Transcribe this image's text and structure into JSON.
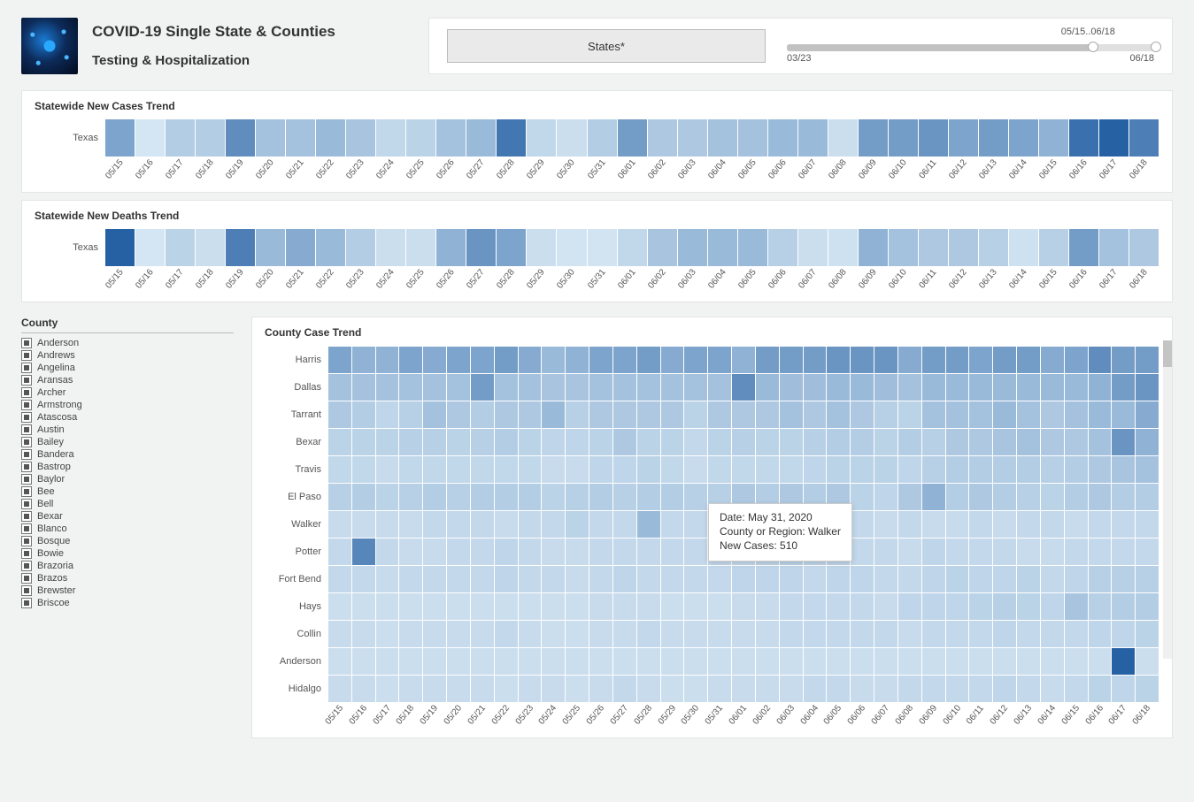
{
  "header": {
    "title": "COVID-19 Single State & Counties",
    "subtitle": "Testing & Hospitalization",
    "states_button": "States*",
    "slider": {
      "range_label": "05/15..06/18",
      "start": "03/23",
      "end": "06/18"
    }
  },
  "cases_trend": {
    "title": "Statewide New Cases Trend",
    "state": "Texas"
  },
  "deaths_trend": {
    "title": "Statewide New Deaths Trend",
    "state": "Texas"
  },
  "county_filter": {
    "title": "County",
    "items": [
      "Anderson",
      "Andrews",
      "Angelina",
      "Aransas",
      "Archer",
      "Armstrong",
      "Atascosa",
      "Austin",
      "Bailey",
      "Bandera",
      "Bastrop",
      "Baylor",
      "Bee",
      "Bell",
      "Bexar",
      "Blanco",
      "Bosque",
      "Bowie",
      "Brazoria",
      "Brazos",
      "Brewster",
      "Briscoe"
    ]
  },
  "county_trend": {
    "title": "County Case Trend",
    "counties": [
      "Harris",
      "Dallas",
      "Tarrant",
      "Bexar",
      "Travis",
      "El Paso",
      "Walker",
      "Potter",
      "Fort Bend",
      "Hays",
      "Collin",
      "Anderson",
      "Hidalgo"
    ]
  },
  "tooltip": {
    "date_label": "Date: May 31, 2020",
    "region_label": "County or Region: Walker",
    "value_label": "New Cases:  510"
  },
  "dates": [
    "05/15",
    "05/16",
    "05/17",
    "05/18",
    "05/19",
    "05/20",
    "05/21",
    "05/22",
    "05/23",
    "05/24",
    "05/25",
    "05/26",
    "05/27",
    "05/28",
    "05/29",
    "05/30",
    "05/31",
    "06/01",
    "06/02",
    "06/03",
    "06/04",
    "06/05",
    "06/06",
    "06/07",
    "06/08",
    "06/09",
    "06/10",
    "06/11",
    "06/12",
    "06/13",
    "06/14",
    "06/15",
    "06/16",
    "06/17",
    "06/18"
  ],
  "chart_data": [
    {
      "type": "heatmap",
      "title": "Statewide New Cases Trend",
      "xlabel": "Date",
      "ylabel": "State",
      "categories": [
        "05/15",
        "05/16",
        "05/17",
        "05/18",
        "05/19",
        "05/20",
        "05/21",
        "05/22",
        "05/23",
        "05/24",
        "05/25",
        "05/26",
        "05/27",
        "05/28",
        "05/29",
        "05/30",
        "05/31",
        "06/01",
        "06/02",
        "06/03",
        "06/04",
        "06/05",
        "06/06",
        "06/07",
        "06/08",
        "06/09",
        "06/10",
        "06/11",
        "06/12",
        "06/13",
        "06/14",
        "06/15",
        "06/16",
        "06/17",
        "06/18"
      ],
      "series": [
        {
          "name": "Texas",
          "values": [
            0.5,
            0.05,
            0.22,
            0.22,
            0.65,
            0.3,
            0.3,
            0.35,
            0.28,
            0.15,
            0.18,
            0.3,
            0.35,
            0.8,
            0.15,
            0.1,
            0.22,
            0.55,
            0.25,
            0.25,
            0.3,
            0.3,
            0.35,
            0.35,
            0.1,
            0.55,
            0.55,
            0.6,
            0.5,
            0.55,
            0.5,
            0.4,
            0.85,
            0.95,
            0.75
          ]
        }
      ],
      "note": "values are relative intensities (0..1) read from color shading; absolute case counts not labeled"
    },
    {
      "type": "heatmap",
      "title": "Statewide New Deaths Trend",
      "xlabel": "Date",
      "ylabel": "State",
      "categories": [
        "05/15",
        "05/16",
        "05/17",
        "05/18",
        "05/19",
        "05/20",
        "05/21",
        "05/22",
        "05/23",
        "05/24",
        "05/25",
        "05/26",
        "05/27",
        "05/28",
        "05/29",
        "05/30",
        "05/31",
        "06/01",
        "06/02",
        "06/03",
        "06/04",
        "06/05",
        "06/06",
        "06/07",
        "06/08",
        "06/09",
        "06/10",
        "06/11",
        "06/12",
        "06/13",
        "06/14",
        "06/15",
        "06/16",
        "06/17",
        "06/18"
      ],
      "series": [
        {
          "name": "Texas",
          "values": [
            0.95,
            0.05,
            0.18,
            0.1,
            0.75,
            0.35,
            0.45,
            0.35,
            0.22,
            0.1,
            0.1,
            0.4,
            0.6,
            0.5,
            0.1,
            0.06,
            0.06,
            0.15,
            0.28,
            0.35,
            0.35,
            0.35,
            0.2,
            0.1,
            0.08,
            0.4,
            0.3,
            0.25,
            0.25,
            0.2,
            0.08,
            0.2,
            0.55,
            0.3,
            0.25
          ]
        }
      ],
      "note": "relative intensities (0..1) from shading"
    },
    {
      "type": "heatmap",
      "title": "County Case Trend",
      "xlabel": "Date",
      "ylabel": "County",
      "categories": [
        "05/15",
        "05/16",
        "05/17",
        "05/18",
        "05/19",
        "05/20",
        "05/21",
        "05/22",
        "05/23",
        "05/24",
        "05/25",
        "05/26",
        "05/27",
        "05/28",
        "05/29",
        "05/30",
        "05/31",
        "06/01",
        "06/02",
        "06/03",
        "06/04",
        "06/05",
        "06/06",
        "06/07",
        "06/08",
        "06/09",
        "06/10",
        "06/11",
        "06/12",
        "06/13",
        "06/14",
        "06/15",
        "06/16",
        "06/17",
        "06/18"
      ],
      "series": [
        {
          "name": "Harris",
          "values": [
            0.5,
            0.4,
            0.4,
            0.5,
            0.45,
            0.5,
            0.5,
            0.55,
            0.45,
            0.35,
            0.4,
            0.5,
            0.5,
            0.55,
            0.45,
            0.5,
            0.5,
            0.4,
            0.55,
            0.55,
            0.55,
            0.6,
            0.6,
            0.6,
            0.45,
            0.55,
            0.55,
            0.5,
            0.55,
            0.55,
            0.45,
            0.5,
            0.65,
            0.55,
            0.55
          ]
        },
        {
          "name": "Dallas",
          "values": [
            0.3,
            0.3,
            0.3,
            0.3,
            0.3,
            0.3,
            0.55,
            0.3,
            0.3,
            0.28,
            0.28,
            0.3,
            0.3,
            0.3,
            0.3,
            0.3,
            0.3,
            0.65,
            0.35,
            0.32,
            0.32,
            0.35,
            0.35,
            0.32,
            0.3,
            0.35,
            0.35,
            0.35,
            0.35,
            0.35,
            0.35,
            0.35,
            0.4,
            0.55,
            0.6
          ]
        },
        {
          "name": "Tarrant",
          "values": [
            0.25,
            0.22,
            0.16,
            0.2,
            0.3,
            0.25,
            0.22,
            0.25,
            0.25,
            0.35,
            0.2,
            0.25,
            0.25,
            0.25,
            0.25,
            0.18,
            0.25,
            0.25,
            0.25,
            0.3,
            0.25,
            0.3,
            0.25,
            0.2,
            0.18,
            0.3,
            0.3,
            0.3,
            0.35,
            0.3,
            0.25,
            0.3,
            0.35,
            0.35,
            0.45
          ]
        },
        {
          "name": "Bexar",
          "values": [
            0.18,
            0.18,
            0.18,
            0.2,
            0.2,
            0.18,
            0.2,
            0.22,
            0.18,
            0.16,
            0.16,
            0.18,
            0.25,
            0.18,
            0.18,
            0.14,
            0.18,
            0.2,
            0.18,
            0.18,
            0.2,
            0.22,
            0.22,
            0.18,
            0.22,
            0.2,
            0.25,
            0.25,
            0.28,
            0.3,
            0.25,
            0.25,
            0.3,
            0.6,
            0.4
          ]
        },
        {
          "name": "Travis",
          "values": [
            0.15,
            0.15,
            0.12,
            0.15,
            0.15,
            0.15,
            0.15,
            0.15,
            0.15,
            0.12,
            0.12,
            0.16,
            0.16,
            0.18,
            0.15,
            0.12,
            0.15,
            0.15,
            0.15,
            0.15,
            0.16,
            0.18,
            0.18,
            0.18,
            0.16,
            0.2,
            0.22,
            0.22,
            0.22,
            0.22,
            0.2,
            0.22,
            0.25,
            0.28,
            0.3
          ]
        },
        {
          "name": "El Paso",
          "values": [
            0.2,
            0.22,
            0.18,
            0.2,
            0.22,
            0.2,
            0.22,
            0.22,
            0.22,
            0.18,
            0.2,
            0.22,
            0.2,
            0.22,
            0.22,
            0.2,
            0.2,
            0.25,
            0.22,
            0.25,
            0.22,
            0.25,
            0.18,
            0.16,
            0.25,
            0.4,
            0.22,
            0.25,
            0.22,
            0.2,
            0.18,
            0.22,
            0.25,
            0.22,
            0.22
          ]
        },
        {
          "name": "Walker",
          "values": [
            0.12,
            0.12,
            0.12,
            0.12,
            0.14,
            0.14,
            0.14,
            0.12,
            0.14,
            0.14,
            0.18,
            0.14,
            0.14,
            0.35,
            0.14,
            0.14,
            0.6,
            0.14,
            0.3,
            0.25,
            0.14,
            0.18,
            0.14,
            0.12,
            0.14,
            0.12,
            0.12,
            0.14,
            0.12,
            0.14,
            0.14,
            0.12,
            0.14,
            0.14,
            0.14
          ]
        },
        {
          "name": "Potter",
          "values": [
            0.14,
            0.7,
            0.14,
            0.12,
            0.12,
            0.14,
            0.14,
            0.16,
            0.14,
            0.12,
            0.12,
            0.14,
            0.14,
            0.14,
            0.14,
            0.14,
            0.14,
            0.14,
            0.16,
            0.18,
            0.16,
            0.16,
            0.14,
            0.14,
            0.12,
            0.16,
            0.14,
            0.14,
            0.14,
            0.12,
            0.12,
            0.14,
            0.14,
            0.14,
            0.14
          ]
        },
        {
          "name": "Fort Bend",
          "values": [
            0.14,
            0.14,
            0.12,
            0.14,
            0.14,
            0.14,
            0.14,
            0.16,
            0.14,
            0.14,
            0.12,
            0.14,
            0.16,
            0.14,
            0.14,
            0.14,
            0.14,
            0.16,
            0.16,
            0.16,
            0.14,
            0.16,
            0.16,
            0.14,
            0.14,
            0.16,
            0.18,
            0.16,
            0.16,
            0.18,
            0.14,
            0.16,
            0.2,
            0.2,
            0.2
          ]
        },
        {
          "name": "Hays",
          "values": [
            0.1,
            0.1,
            0.1,
            0.1,
            0.1,
            0.1,
            0.1,
            0.1,
            0.1,
            0.1,
            0.1,
            0.12,
            0.12,
            0.12,
            0.1,
            0.1,
            0.1,
            0.12,
            0.12,
            0.14,
            0.14,
            0.14,
            0.14,
            0.12,
            0.16,
            0.16,
            0.16,
            0.18,
            0.2,
            0.18,
            0.16,
            0.28,
            0.2,
            0.22,
            0.22
          ]
        },
        {
          "name": "Collin",
          "values": [
            0.12,
            0.12,
            0.1,
            0.12,
            0.12,
            0.12,
            0.12,
            0.14,
            0.12,
            0.1,
            0.1,
            0.12,
            0.12,
            0.14,
            0.12,
            0.12,
            0.12,
            0.12,
            0.12,
            0.14,
            0.14,
            0.14,
            0.14,
            0.14,
            0.12,
            0.14,
            0.14,
            0.14,
            0.16,
            0.14,
            0.14,
            0.14,
            0.16,
            0.16,
            0.18
          ]
        },
        {
          "name": "Anderson",
          "values": [
            0.1,
            0.1,
            0.1,
            0.1,
            0.1,
            0.1,
            0.1,
            0.1,
            0.1,
            0.1,
            0.1,
            0.1,
            0.1,
            0.1,
            0.1,
            0.1,
            0.1,
            0.1,
            0.1,
            0.1,
            0.1,
            0.1,
            0.1,
            0.1,
            0.1,
            0.1,
            0.1,
            0.1,
            0.1,
            0.1,
            0.1,
            0.1,
            0.1,
            0.95,
            0.1
          ]
        },
        {
          "name": "Hidalgo",
          "values": [
            0.12,
            0.12,
            0.1,
            0.12,
            0.12,
            0.12,
            0.12,
            0.1,
            0.12,
            0.12,
            0.1,
            0.12,
            0.14,
            0.12,
            0.1,
            0.1,
            0.12,
            0.12,
            0.12,
            0.12,
            0.14,
            0.14,
            0.12,
            0.12,
            0.14,
            0.14,
            0.14,
            0.14,
            0.16,
            0.14,
            0.12,
            0.14,
            0.18,
            0.16,
            0.18
          ]
        }
      ],
      "highlight": {
        "row": "Walker",
        "col": "05/31",
        "value": 510,
        "date_full": "May 31, 2020"
      },
      "note": "relative intensities (0..1) from shading; one labeled point: Walker 05/31 = 510 new cases"
    }
  ]
}
